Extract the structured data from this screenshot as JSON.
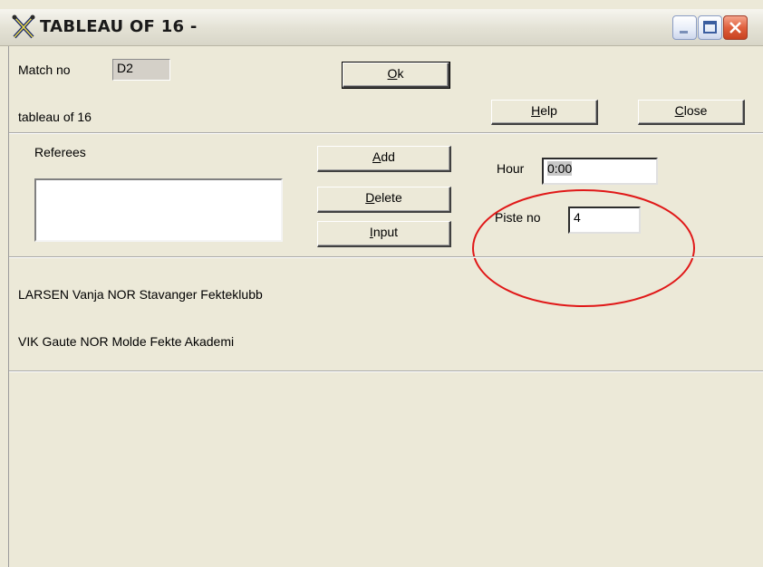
{
  "window": {
    "title": "TABLEAU OF 16 -"
  },
  "match": {
    "label": "Match no",
    "value": "D2"
  },
  "tableau_label": "tableau of 16",
  "buttons": {
    "ok": {
      "mnemonic": "O",
      "rest": "k"
    },
    "help": {
      "mnemonic": "H",
      "rest": "elp"
    },
    "close": {
      "mnemonic": "C",
      "rest": "lose"
    },
    "add": {
      "mnemonic": "A",
      "rest": "dd"
    },
    "delete": {
      "mnemonic": "D",
      "rest": "elete"
    },
    "input": {
      "mnemonic": "I",
      "rest": "nput"
    }
  },
  "referees": {
    "label": "Referees",
    "items": []
  },
  "hour": {
    "label": "Hour",
    "value": "0:00"
  },
  "piste": {
    "label": "Piste no",
    "value": "4"
  },
  "fencers": [
    "LARSEN Vanja NOR Stavanger Fekteklubb",
    "VIK Gaute NOR Molde Fekte Akademi"
  ],
  "colors": {
    "highlight_ellipse": "#e01818",
    "window_bg": "#ece9d8"
  }
}
